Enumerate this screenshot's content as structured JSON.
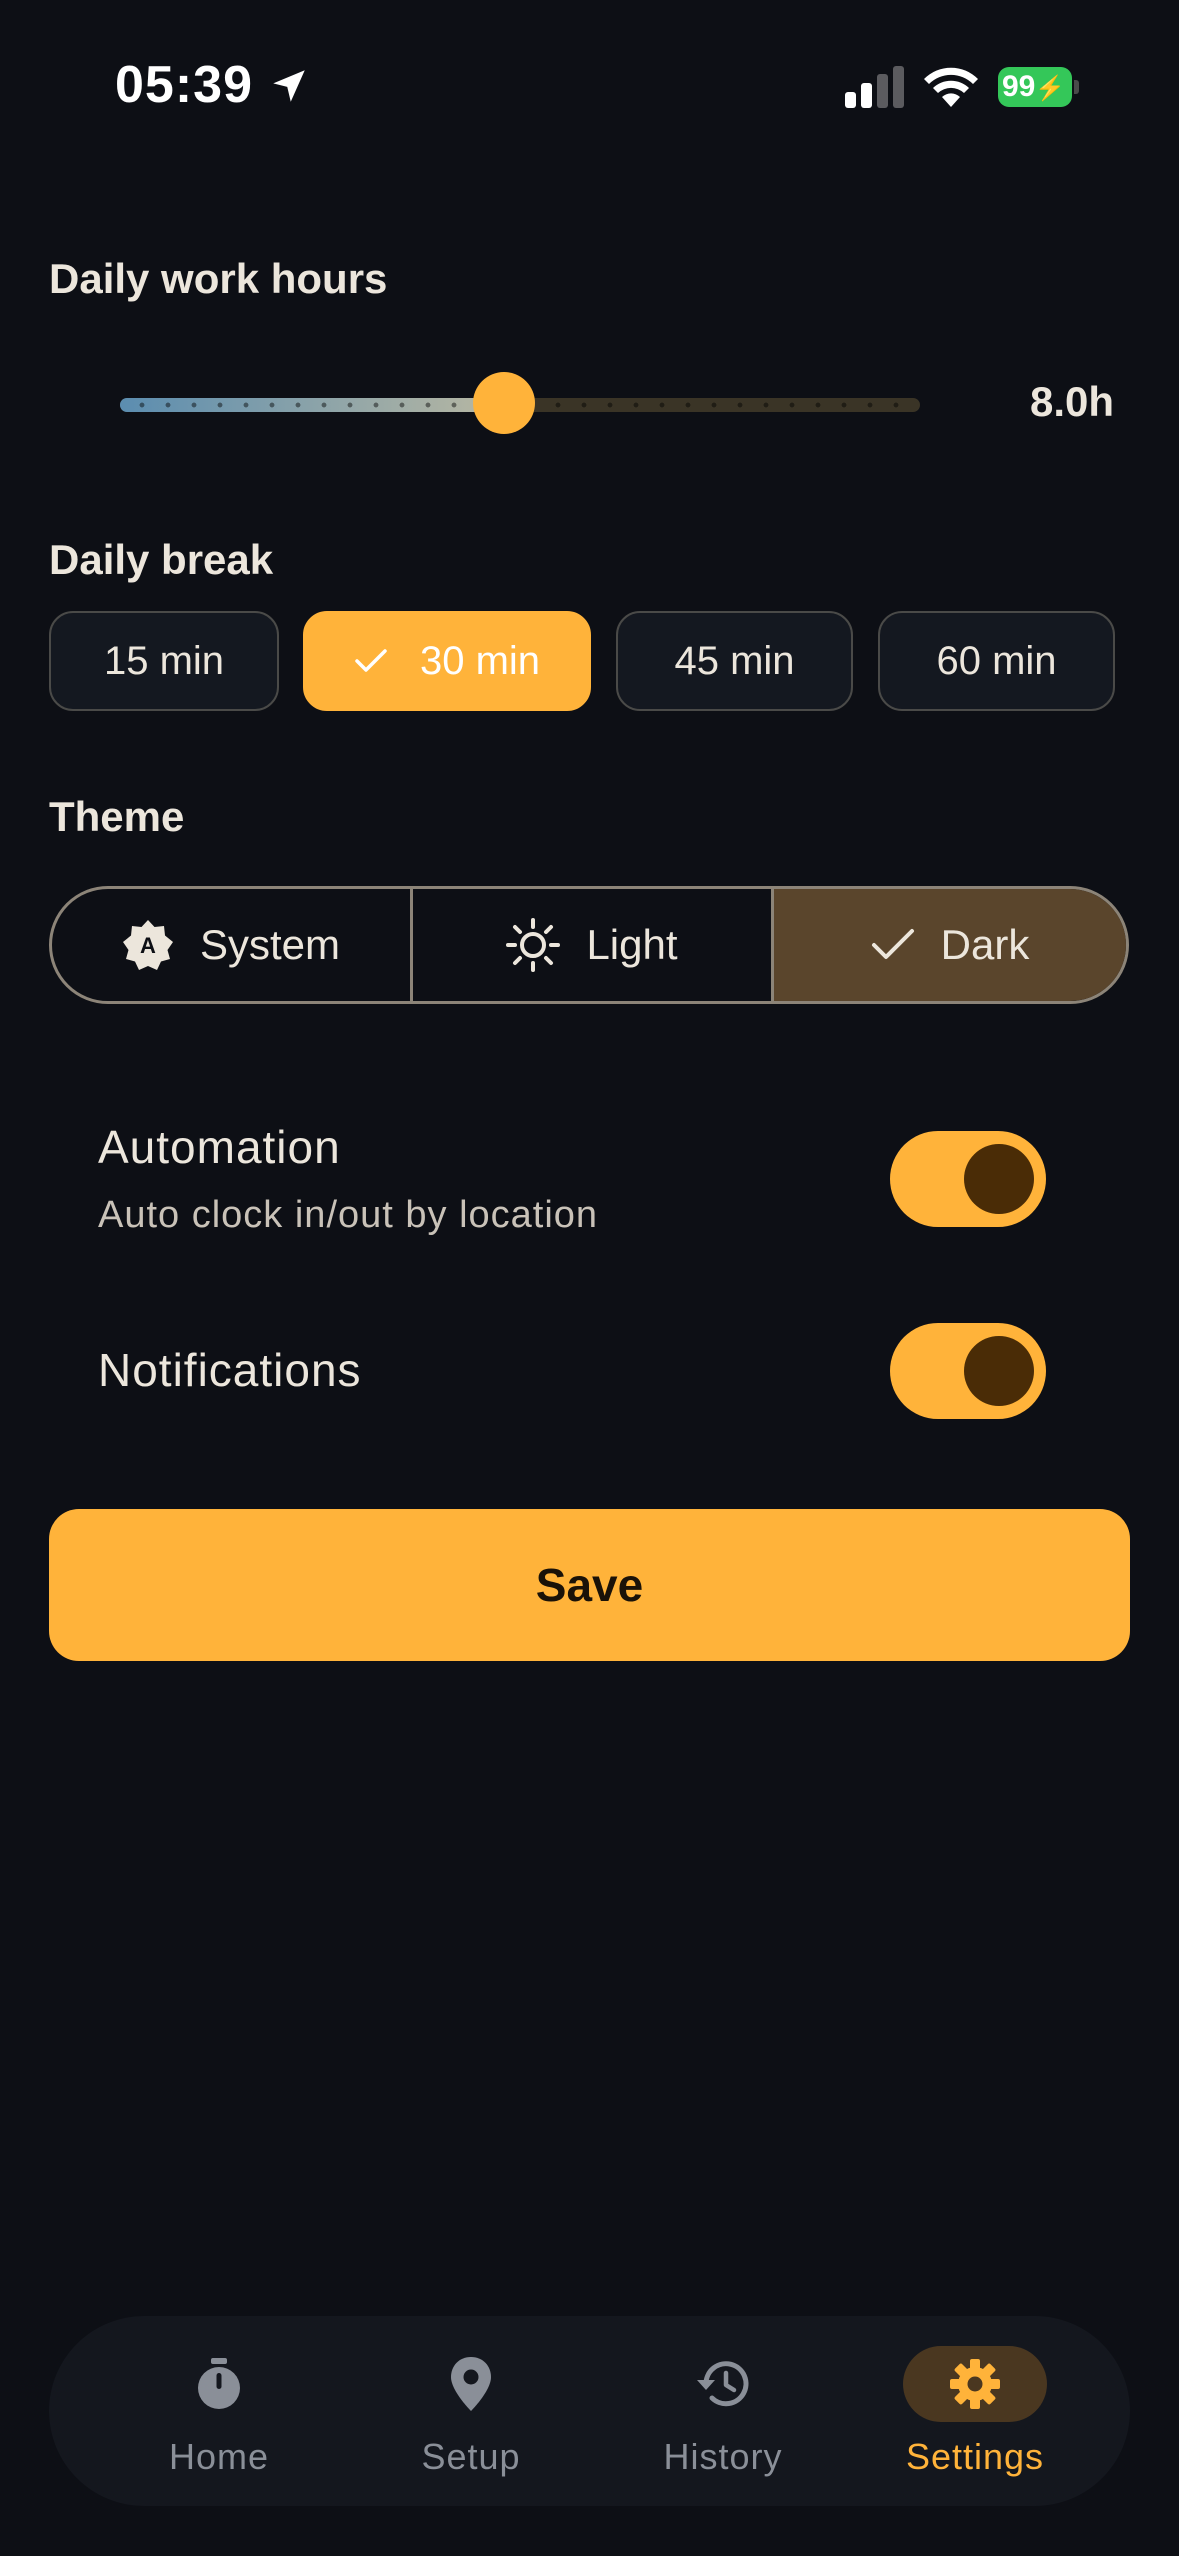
{
  "status_bar": {
    "time": "05:39",
    "battery_level": "99",
    "battery_charging": true,
    "colors": {
      "battery": "#34c759"
    }
  },
  "work_hours": {
    "label": "Daily work hours",
    "value_text": "8.0h",
    "value": 8.0,
    "slider_fraction": 0.48
  },
  "break": {
    "label": "Daily break",
    "options": [
      "15 min",
      "30 min",
      "45 min",
      "60 min"
    ],
    "selected": "30 min"
  },
  "theme": {
    "label": "Theme",
    "options": [
      {
        "label": "System",
        "icon": "brightness-auto-icon"
      },
      {
        "label": "Light",
        "icon": "sun-icon"
      },
      {
        "label": "Dark",
        "icon": "check-icon"
      }
    ],
    "selected": "Dark"
  },
  "automation": {
    "title": "Automation",
    "subtitle": "Auto clock in/out by location",
    "enabled": true
  },
  "notifications": {
    "title": "Notifications",
    "enabled": true
  },
  "save_label": "Save",
  "tabbar": {
    "tabs": [
      {
        "label": "Home",
        "icon": "stopwatch-icon"
      },
      {
        "label": "Setup",
        "icon": "location-pin-icon"
      },
      {
        "label": "History",
        "icon": "history-icon"
      },
      {
        "label": "Settings",
        "icon": "gear-icon"
      }
    ],
    "active": "Settings"
  },
  "colors": {
    "background": "#0d0f15",
    "accent": "#ffb33a",
    "text": "#ece6dc",
    "selected_segment": "#5a452c",
    "inactive_tab": "#8a8f98"
  }
}
